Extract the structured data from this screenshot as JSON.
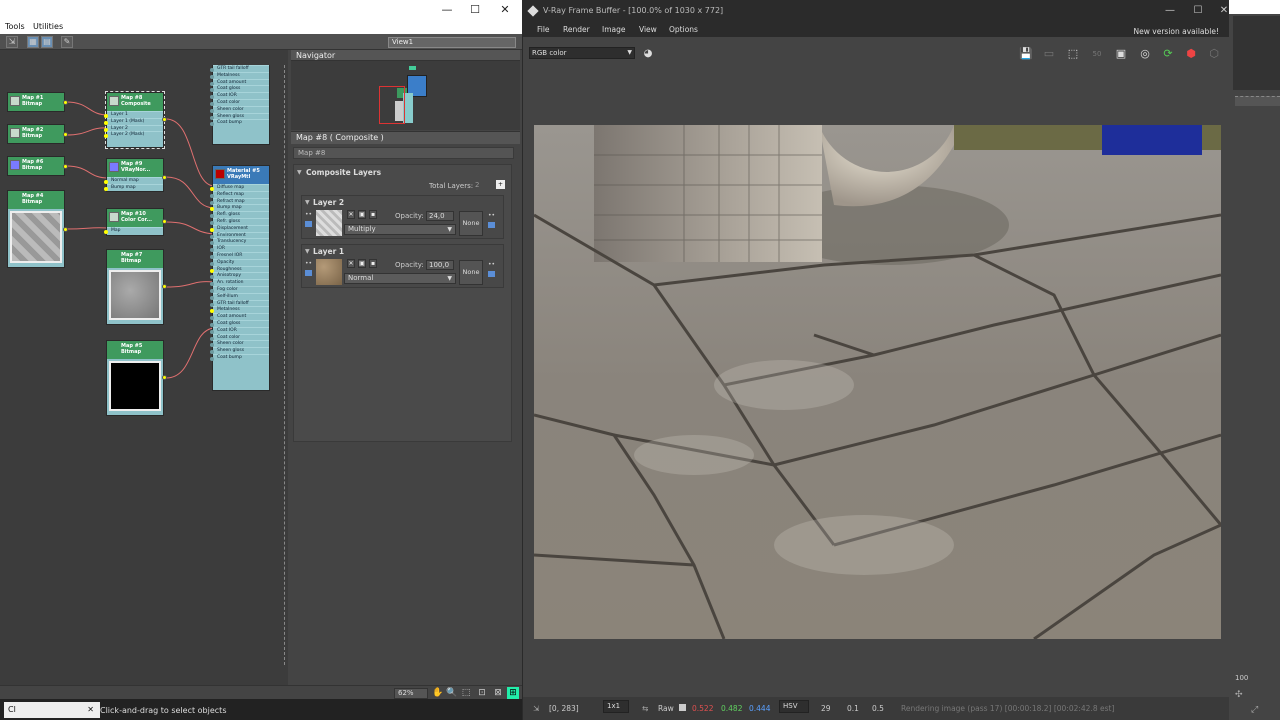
{
  "slate": {
    "menu": {
      "tools": "Tools",
      "utilities": "Utilities"
    },
    "window_controls": {
      "minimize": "—",
      "maximize": "☐",
      "close": "✕"
    },
    "view_select": "View1",
    "nodes": [
      {
        "id": "map1",
        "title": "Map #1",
        "type": "Bitmap"
      },
      {
        "id": "map2",
        "title": "Map #2",
        "type": "Bitmap"
      },
      {
        "id": "map6",
        "title": "Map #6",
        "type": "Bitmap"
      },
      {
        "id": "map4",
        "title": "Map #4",
        "type": "Bitmap"
      },
      {
        "id": "map8",
        "title": "Map #8",
        "type": "Composite"
      },
      {
        "id": "map9",
        "title": "Map #9",
        "type": "VRayNor..."
      },
      {
        "id": "map10",
        "title": "Map #10",
        "type": "Color Cor..."
      },
      {
        "id": "map7",
        "title": "Map #7",
        "type": "Bitmap"
      },
      {
        "id": "map5",
        "title": "Map #5",
        "type": "Bitmap"
      },
      {
        "id": "material",
        "title": "Material #5",
        "type": "VRayMtl"
      }
    ],
    "composite_inputs": [
      "Layer 1",
      "Layer 1 (Mask)",
      "Layer 2",
      "Layer 2 (Mask)"
    ],
    "normal_inputs": [
      "Normal map",
      "Bump map"
    ],
    "color_inputs": [
      "Map"
    ],
    "material_slots": [
      "Diffuse map",
      "Reflect map",
      "Refract map",
      "Bump map",
      "Refl. gloss",
      "Refr. gloss",
      "Displacement",
      "Environment",
      "Translucency",
      "IOR",
      "Fresnel IOR",
      "Opacity",
      "Roughness",
      "Anisotropy",
      "An. rotation",
      "Fog color",
      "Self-illum",
      "GTR tail falloff",
      "Metalness",
      "Coat amount",
      "Coat gloss",
      "Coat IOR",
      "Coat color",
      "Sheen color",
      "Sheen gloss",
      "Coat bump"
    ],
    "top_stub_slots": [
      "GTR tail falloff",
      "Metalness",
      "Coat amount",
      "Coat gloss",
      "Coat IOR",
      "Coat color",
      "Sheen color",
      "Sheen gloss",
      "Coat bump"
    ],
    "navigator": {
      "title": "Navigator"
    },
    "param_editor": {
      "title": "Map #8  ( Composite )",
      "map_name": "Map #8",
      "rollout_title": "Composite Layers",
      "total_layers_label": "Total Layers:",
      "total_layers_value": "2",
      "layers": [
        {
          "name": "Layer 2",
          "opacity_label": "Opacity:",
          "opacity": "24,0",
          "blend": "Multiply",
          "none_label": "None"
        },
        {
          "name": "Layer 1",
          "opacity_label": "Opacity:",
          "opacity": "100,0",
          "blend": "Normal",
          "none_label": "None"
        }
      ]
    },
    "zoom": "62%",
    "status": "Click-and-drag to select objects",
    "task_item": "Cl"
  },
  "vfb": {
    "title": "V-Ray Frame Buffer - [100.0% of 1030 x 772]",
    "menu": [
      "File",
      "Render",
      "Image",
      "View",
      "Options"
    ],
    "new_version": "New version available!",
    "channel": "RGB color",
    "status": {
      "coords": "[0, 283]",
      "scale": "1x1",
      "raw": "Raw",
      "r": "0.522",
      "g": "0.482",
      "b": "0.444",
      "colorspace": "HSV",
      "h": "29",
      "s": "0.1",
      "v": "0.5",
      "progress": "Rendering image (pass 17) [00:00:18.2] [00:02:42.8 est]"
    },
    "colors": {
      "r": "#e05050",
      "g": "#60d060",
      "b": "#5aa0ff"
    }
  },
  "right_panel": {
    "value": "100"
  }
}
